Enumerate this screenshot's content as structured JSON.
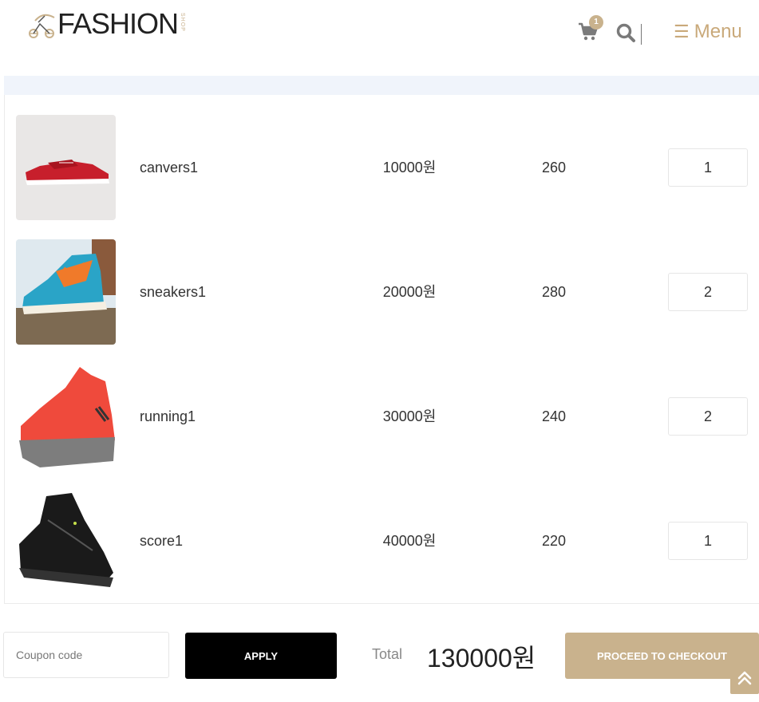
{
  "brand": {
    "name": "FASHION",
    "sub": "SHOP"
  },
  "header": {
    "cart_count": "1",
    "menu_label": "Menu",
    "menu_icon": "☰"
  },
  "cart": {
    "items": [
      {
        "name": "canvers1",
        "price": "10000원",
        "size": "260",
        "qty": "1",
        "image": "red-canvas-sneaker"
      },
      {
        "name": "sneakers1",
        "price": "20000원",
        "size": "280",
        "qty": "2",
        "image": "blue-orange-high-top"
      },
      {
        "name": "running1",
        "price": "30000원",
        "size": "240",
        "qty": "2",
        "image": "red-running-shoe"
      },
      {
        "name": "score1",
        "price": "40000원",
        "size": "220",
        "qty": "1",
        "image": "black-hiking-boot"
      }
    ]
  },
  "footer": {
    "coupon_placeholder": "Coupon code",
    "apply_label": "APPLY",
    "total_label": "Total",
    "total_value": "130000원",
    "checkout_label": "PROCEED TO CHECKOUT"
  },
  "colors": {
    "accent": "#c9b28d",
    "menu": "#c9a97a",
    "table_head": "#f0f4fb",
    "apply_bg": "#000000"
  }
}
